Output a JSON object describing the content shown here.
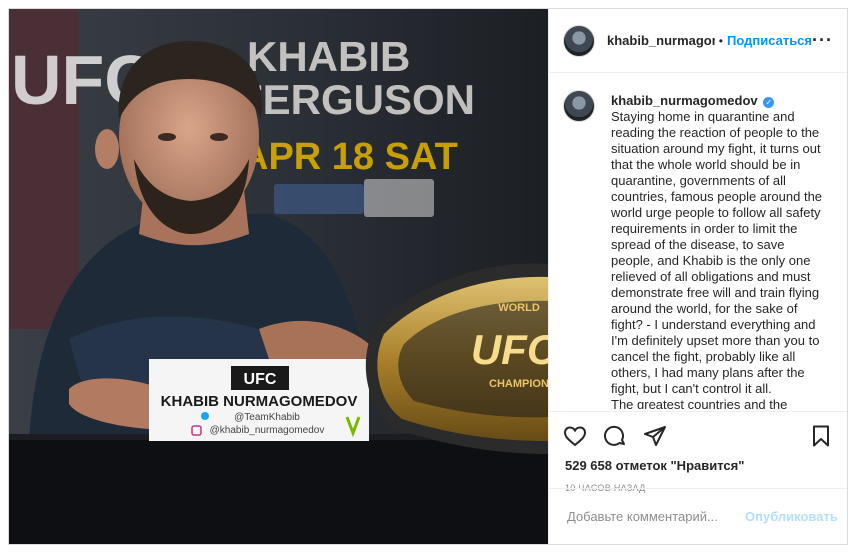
{
  "post": {
    "username": "khabib_nurmagomedov",
    "header_username": "khabib_nurmagomedov",
    "follow_label": "Подписаться",
    "caption": "Staying home in quarantine and reading the reaction of people to the situation around my fight, it turns out that the whole world should be in quarantine, governments of all countries, famous people around the world urge people to follow all safety requirements in order to limit the spread of the disease, to save people, and Khabib is the only one relieved of all obligations and must demonstrate free will and train flying around the world, for the sake of fight? - I understand everything and I'm definitely upset more than you to cancel the fight, probably like all others, I had many plans after the fight, but I can't control it all.",
    "caption_more": "The greatest countries and the largest",
    "likes": "529 658 отметок \"Нравится\"",
    "time": "10 часов назад",
    "comment_placeholder": "Добавьте комментарий...",
    "publish_label": "Опубликовать"
  },
  "photo": {
    "banner_line1": "KHABIB",
    "banner_line2": "FERGUSON",
    "banner_line3": "APR 18 SAT",
    "brand": "UFC",
    "nameplate_brand": "UFC",
    "nameplate_name": "KHABIB NURMAGOMEDOV",
    "nameplate_twitter": "@TeamKhabib",
    "nameplate_instagram": "@khabib_nurmagomedov",
    "belt_text": "UFC",
    "belt_top": "WORLD",
    "belt_bottom": "CHAMPION"
  },
  "icons": [
    "heart-icon",
    "comment-icon",
    "share-icon",
    "bookmark-icon",
    "more-options-icon",
    "verified-badge-icon"
  ],
  "colors": {
    "accent": "#0095f6",
    "publish_disabled": "#b2dffc",
    "verified": "#3897f0"
  }
}
